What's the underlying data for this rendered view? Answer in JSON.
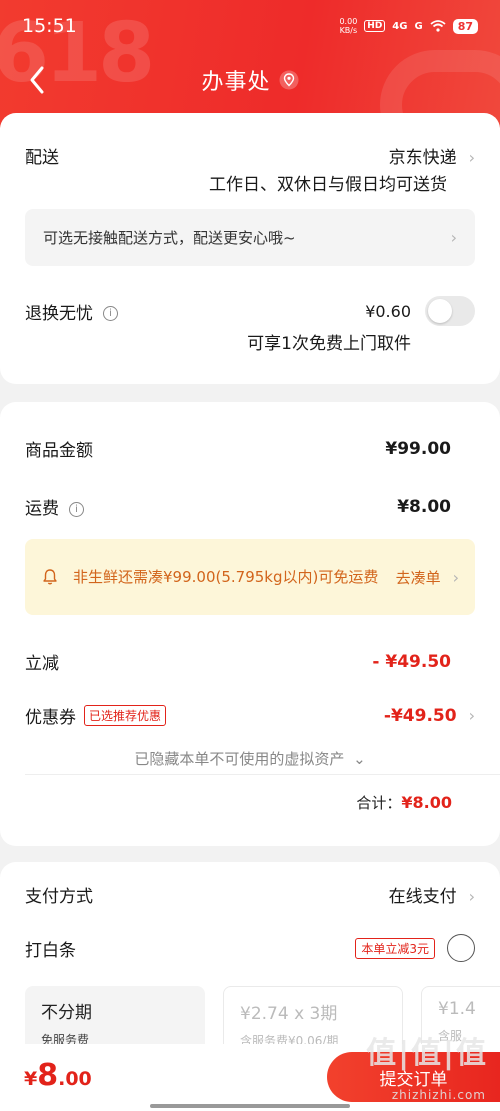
{
  "status_bar": {
    "time": "15:51",
    "net_speed_value": "0.00",
    "net_speed_unit": "KB/s",
    "hd_label": "HD",
    "signal_1": "4G",
    "signal_2": "G",
    "battery": "87"
  },
  "nav": {
    "title": "办事处"
  },
  "delivery": {
    "label": "配送",
    "carrier": "京东快递",
    "note": "工作日、双休日与假日均可送货",
    "contactless_tip": "可选无接触配送方式，配送更安心哦~"
  },
  "return_service": {
    "label": "退换无忧",
    "price": "¥0.60",
    "desc": "可享1次免费上门取件",
    "enabled": false
  },
  "summary": {
    "goods_label": "商品金额",
    "goods_value": "¥99.00",
    "freight_label": "运费",
    "freight_value": "¥8.00",
    "freight_tip": "非生鲜还需凑¥99.00(5.795kg以内)可免运费",
    "freight_tip_link": "去凑单",
    "discount_label": "立减",
    "discount_value": "- ¥49.50",
    "coupon_label": "优惠券",
    "coupon_tag": "已选推荐优惠",
    "coupon_value": "-¥49.50",
    "hidden_assets": "已隐藏本单不可使用的虚拟资产",
    "total_label": "合计：",
    "total_value": "¥8.00"
  },
  "payment": {
    "method_label": "支付方式",
    "method_value": "在线支付",
    "baitiao_label": "打白条",
    "baitiao_promo": "本单立减3元",
    "plans": [
      {
        "title": "不分期",
        "sub": "免服务费"
      },
      {
        "title": "¥2.74 x 3期",
        "sub": "含服务费¥0.06/期"
      },
      {
        "title": "¥1.4",
        "sub": "含服"
      }
    ]
  },
  "bottom_bar": {
    "currency": "¥",
    "amount_int": "8",
    "amount_dec": ".00",
    "submit_label": "提交订单"
  },
  "decor": {
    "promo_mark": "618"
  },
  "watermark": {
    "main": "值|值|值",
    "sub": "zhizhizhi.com"
  },
  "colors": {
    "brand_red": "#e2231a",
    "header_red": "#ee2b2a",
    "tip_bg": "#fdf6d9",
    "tip_text": "#d2651c"
  }
}
